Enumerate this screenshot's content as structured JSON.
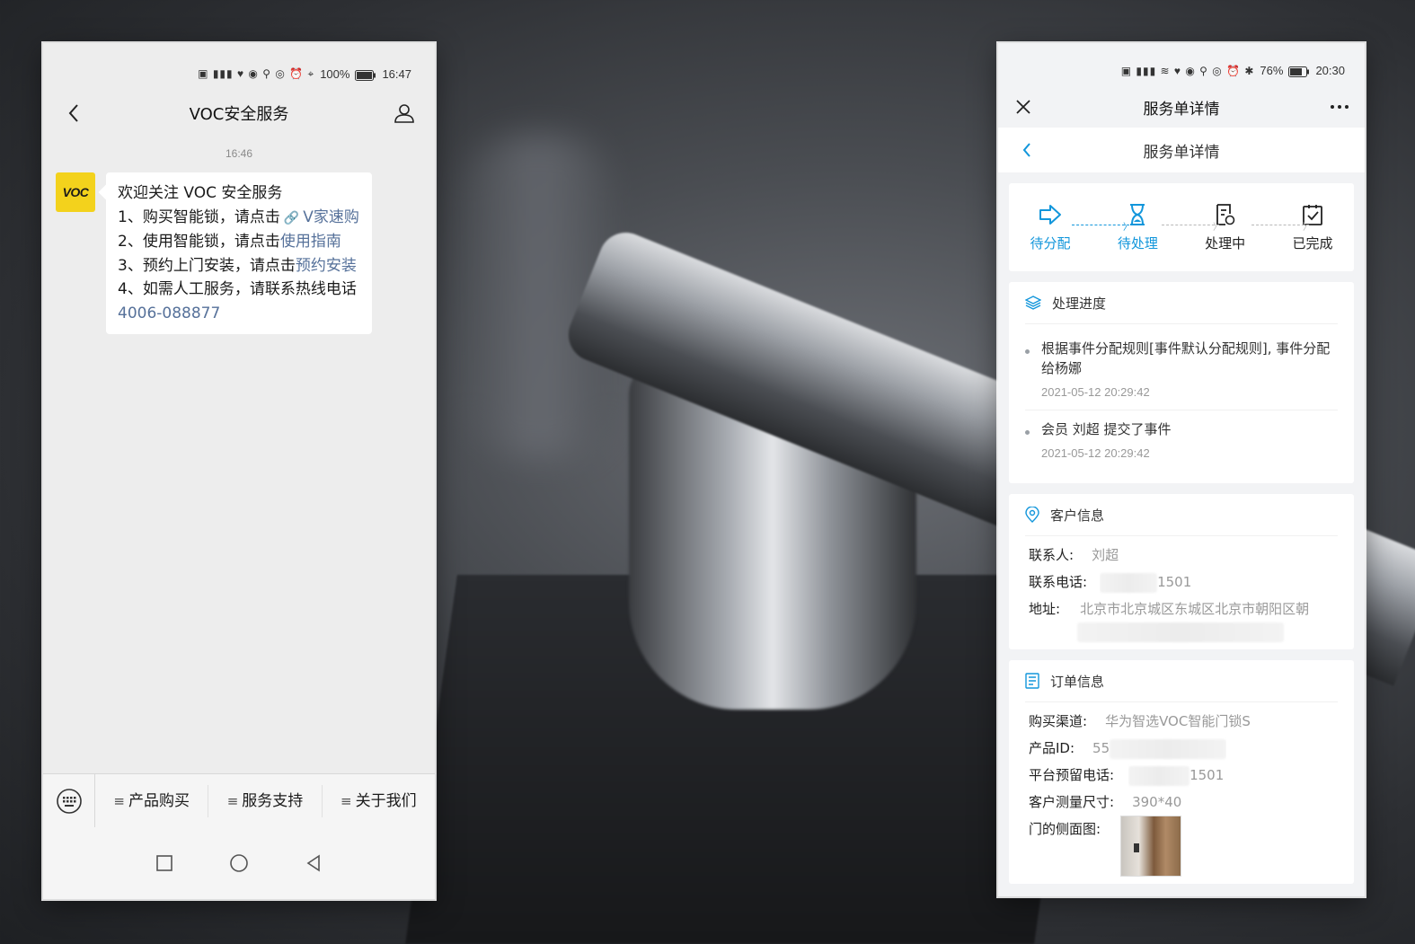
{
  "left_phone": {
    "status": {
      "battery": "100%",
      "time": "16:47"
    },
    "nav": {
      "title": "VOC安全服务"
    },
    "chat": {
      "timestamp": "16:46",
      "avatar_text": "VOC",
      "lines": {
        "l0": "欢迎关注 VOC 安全服务",
        "l1_prefix": "1、购买智能锁，请点击",
        "l1_link": "V家速购",
        "l2_prefix": "2、使用智能锁，请点击",
        "l2_link": "使用指南",
        "l3_prefix": "3、预约上门安装，请点击",
        "l3_link": "预约安装",
        "l4_prefix": "4、如需人工服务，请联系热线电话",
        "l4_link": "4006-088877"
      }
    },
    "menu": {
      "item1": "产品购买",
      "item2": "服务支持",
      "item3": "关于我们"
    }
  },
  "right_phone": {
    "status": {
      "battery": "76%",
      "time": "20:30"
    },
    "nav": {
      "title": "服务单详情"
    },
    "subnav": {
      "title": "服务单详情"
    },
    "steps": [
      {
        "label": "待分配"
      },
      {
        "label": "待处理"
      },
      {
        "label": "处理中"
      },
      {
        "label": "已完成"
      }
    ],
    "progress": {
      "title": "处理进度",
      "items": [
        {
          "text": "根据事件分配规则[事件默认分配规则], 事件分配给杨娜",
          "time": "2021-05-12 20:29:42"
        },
        {
          "text": "会员 刘超 提交了事件",
          "time": "2021-05-12 20:29:42"
        }
      ]
    },
    "customer": {
      "title": "客户信息",
      "contact_label": "联系人:",
      "contact_value": "刘超",
      "phone_label": "联系电话:",
      "phone_value": "1501",
      "address_label": "地址:",
      "address_value": "北京市北京城区东城区北京市朝阳区朝"
    },
    "order": {
      "title": "订单信息",
      "channel_label": "购买渠道:",
      "channel_value": "华为智选VOC智能门锁S",
      "product_label": "产品ID:",
      "product_value": "55",
      "platform_phone_label": "平台预留电话:",
      "platform_phone_value": "1501",
      "size_label": "客户测量尺寸:",
      "size_value": "390*40",
      "door_label": "门的侧面图:"
    }
  },
  "colors": {
    "accent": "#1296db",
    "link": "#56719a",
    "avatar_bg": "#f3d21c"
  }
}
